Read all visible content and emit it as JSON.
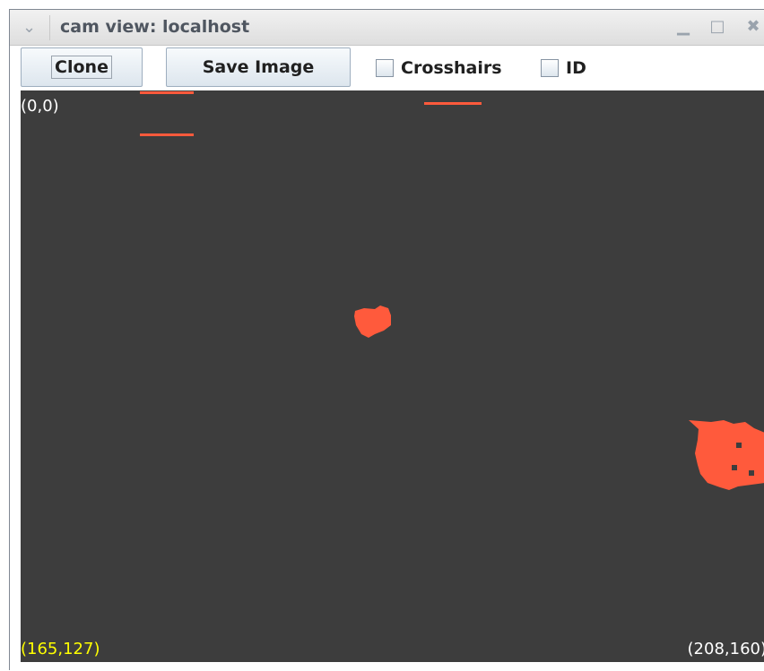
{
  "window": {
    "title": "cam view: localhost"
  },
  "toolbar": {
    "clone_label": "Clone",
    "save_image_label": "Save Image",
    "crosshairs_label": "Crosshairs",
    "id_label": "ID",
    "crosshairs_checked": false,
    "id_checked": false
  },
  "view": {
    "top_left_coord": "(0,0)",
    "bottom_left_coord": "(165,127)",
    "bottom_right_coord": "(208,160)"
  },
  "colors": {
    "view_background": "#3d3d3d",
    "blob_color": "#ff5a3c",
    "bottom_left_coord_color": "#ffff00",
    "coord_text_color": "#ffffff"
  },
  "icons": {
    "menu": "chevron-down-icon",
    "minimize": "minimize-icon",
    "maximize": "maximize-icon",
    "close": "close-icon"
  }
}
